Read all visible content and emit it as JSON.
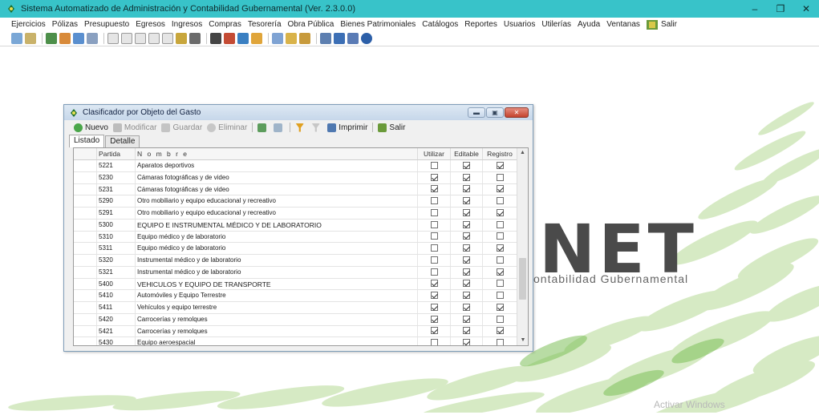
{
  "app": {
    "title": "Sistema Automatizado de Administración y Contabilidad Gubernamental  (Ver. 2.3.0.0)",
    "window_controls": [
      "–",
      "❐",
      "✕"
    ]
  },
  "menu": [
    "Ejercicios",
    "Pólizas",
    "Presupuesto",
    "Egresos",
    "Ingresos",
    "Compras",
    "Tesorería",
    "Obra Pública",
    "Bienes Patrimoniales",
    "Catálogos",
    "Reportes",
    "Usuarios",
    "Utilerías",
    "Ayuda",
    "Ventanas"
  ],
  "menu_exit": "Salir",
  "background": {
    "logo_text": "NET",
    "logo_subtitle": "ontabilidad Gubernamental",
    "watermark": "Activar Windows"
  },
  "child_window": {
    "title": "Clasificador por Objeto del Gasto",
    "toolbar": {
      "nuevo": "Nuevo",
      "modificar": "Modificar",
      "guardar": "Guardar",
      "eliminar": "Eliminar",
      "imprimir": "Imprimir",
      "salir": "Salir"
    },
    "tabs": [
      "Listado",
      "Detalle"
    ],
    "columns": [
      "Partida",
      "N o m b r e",
      "Utilizar",
      "Editable",
      "Registro"
    ],
    "rows": [
      {
        "partida": "5221",
        "nombre": "Aparatos deportivos",
        "utilizar": false,
        "editable": true,
        "registro": true
      },
      {
        "partida": "5230",
        "nombre": "Cámaras fotográficas y de video",
        "utilizar": true,
        "editable": true,
        "registro": false
      },
      {
        "partida": "5231",
        "nombre": "Cámaras fotográficas y de video",
        "utilizar": true,
        "editable": true,
        "registro": true
      },
      {
        "partida": "5290",
        "nombre": "Otro mobiliario y equipo educacional y recreativo",
        "utilizar": false,
        "editable": true,
        "registro": false
      },
      {
        "partida": "5291",
        "nombre": "Otro mobiliario y equipo educacional y recreativo",
        "utilizar": false,
        "editable": true,
        "registro": true
      },
      {
        "partida": "5300",
        "nombre": "EQUIPO E INSTRUMENTAL MÉDICO Y DE LABORATORIO",
        "utilizar": false,
        "editable": true,
        "registro": false
      },
      {
        "partida": "5310",
        "nombre": "Equipo médico y de laboratorio",
        "utilizar": false,
        "editable": true,
        "registro": false
      },
      {
        "partida": "5311",
        "nombre": "Equipo médico y de laboratorio",
        "utilizar": false,
        "editable": true,
        "registro": true
      },
      {
        "partida": "5320",
        "nombre": "Instrumental médico y de laboratorio",
        "utilizar": false,
        "editable": true,
        "registro": false
      },
      {
        "partida": "5321",
        "nombre": "Instrumental médico y de laboratorio",
        "utilizar": false,
        "editable": true,
        "registro": true
      },
      {
        "partida": "5400",
        "nombre": "VEHICULOS Y EQUIPO DE TRANSPORTE",
        "utilizar": true,
        "editable": true,
        "registro": false
      },
      {
        "partida": "5410",
        "nombre": "Automóviles y Equipo Terrestre",
        "utilizar": true,
        "editable": true,
        "registro": false
      },
      {
        "partida": "5411",
        "nombre": "Vehículos y equipo terrestre",
        "utilizar": true,
        "editable": true,
        "registro": true
      },
      {
        "partida": "5420",
        "nombre": "Carrocerías y remolques",
        "utilizar": true,
        "editable": true,
        "registro": false
      },
      {
        "partida": "5421",
        "nombre": "Carrocerías y remolques",
        "utilizar": true,
        "editable": true,
        "registro": true
      },
      {
        "partida": "5430",
        "nombre": "Equipo aeroespacial",
        "utilizar": false,
        "editable": true,
        "registro": false
      }
    ]
  }
}
